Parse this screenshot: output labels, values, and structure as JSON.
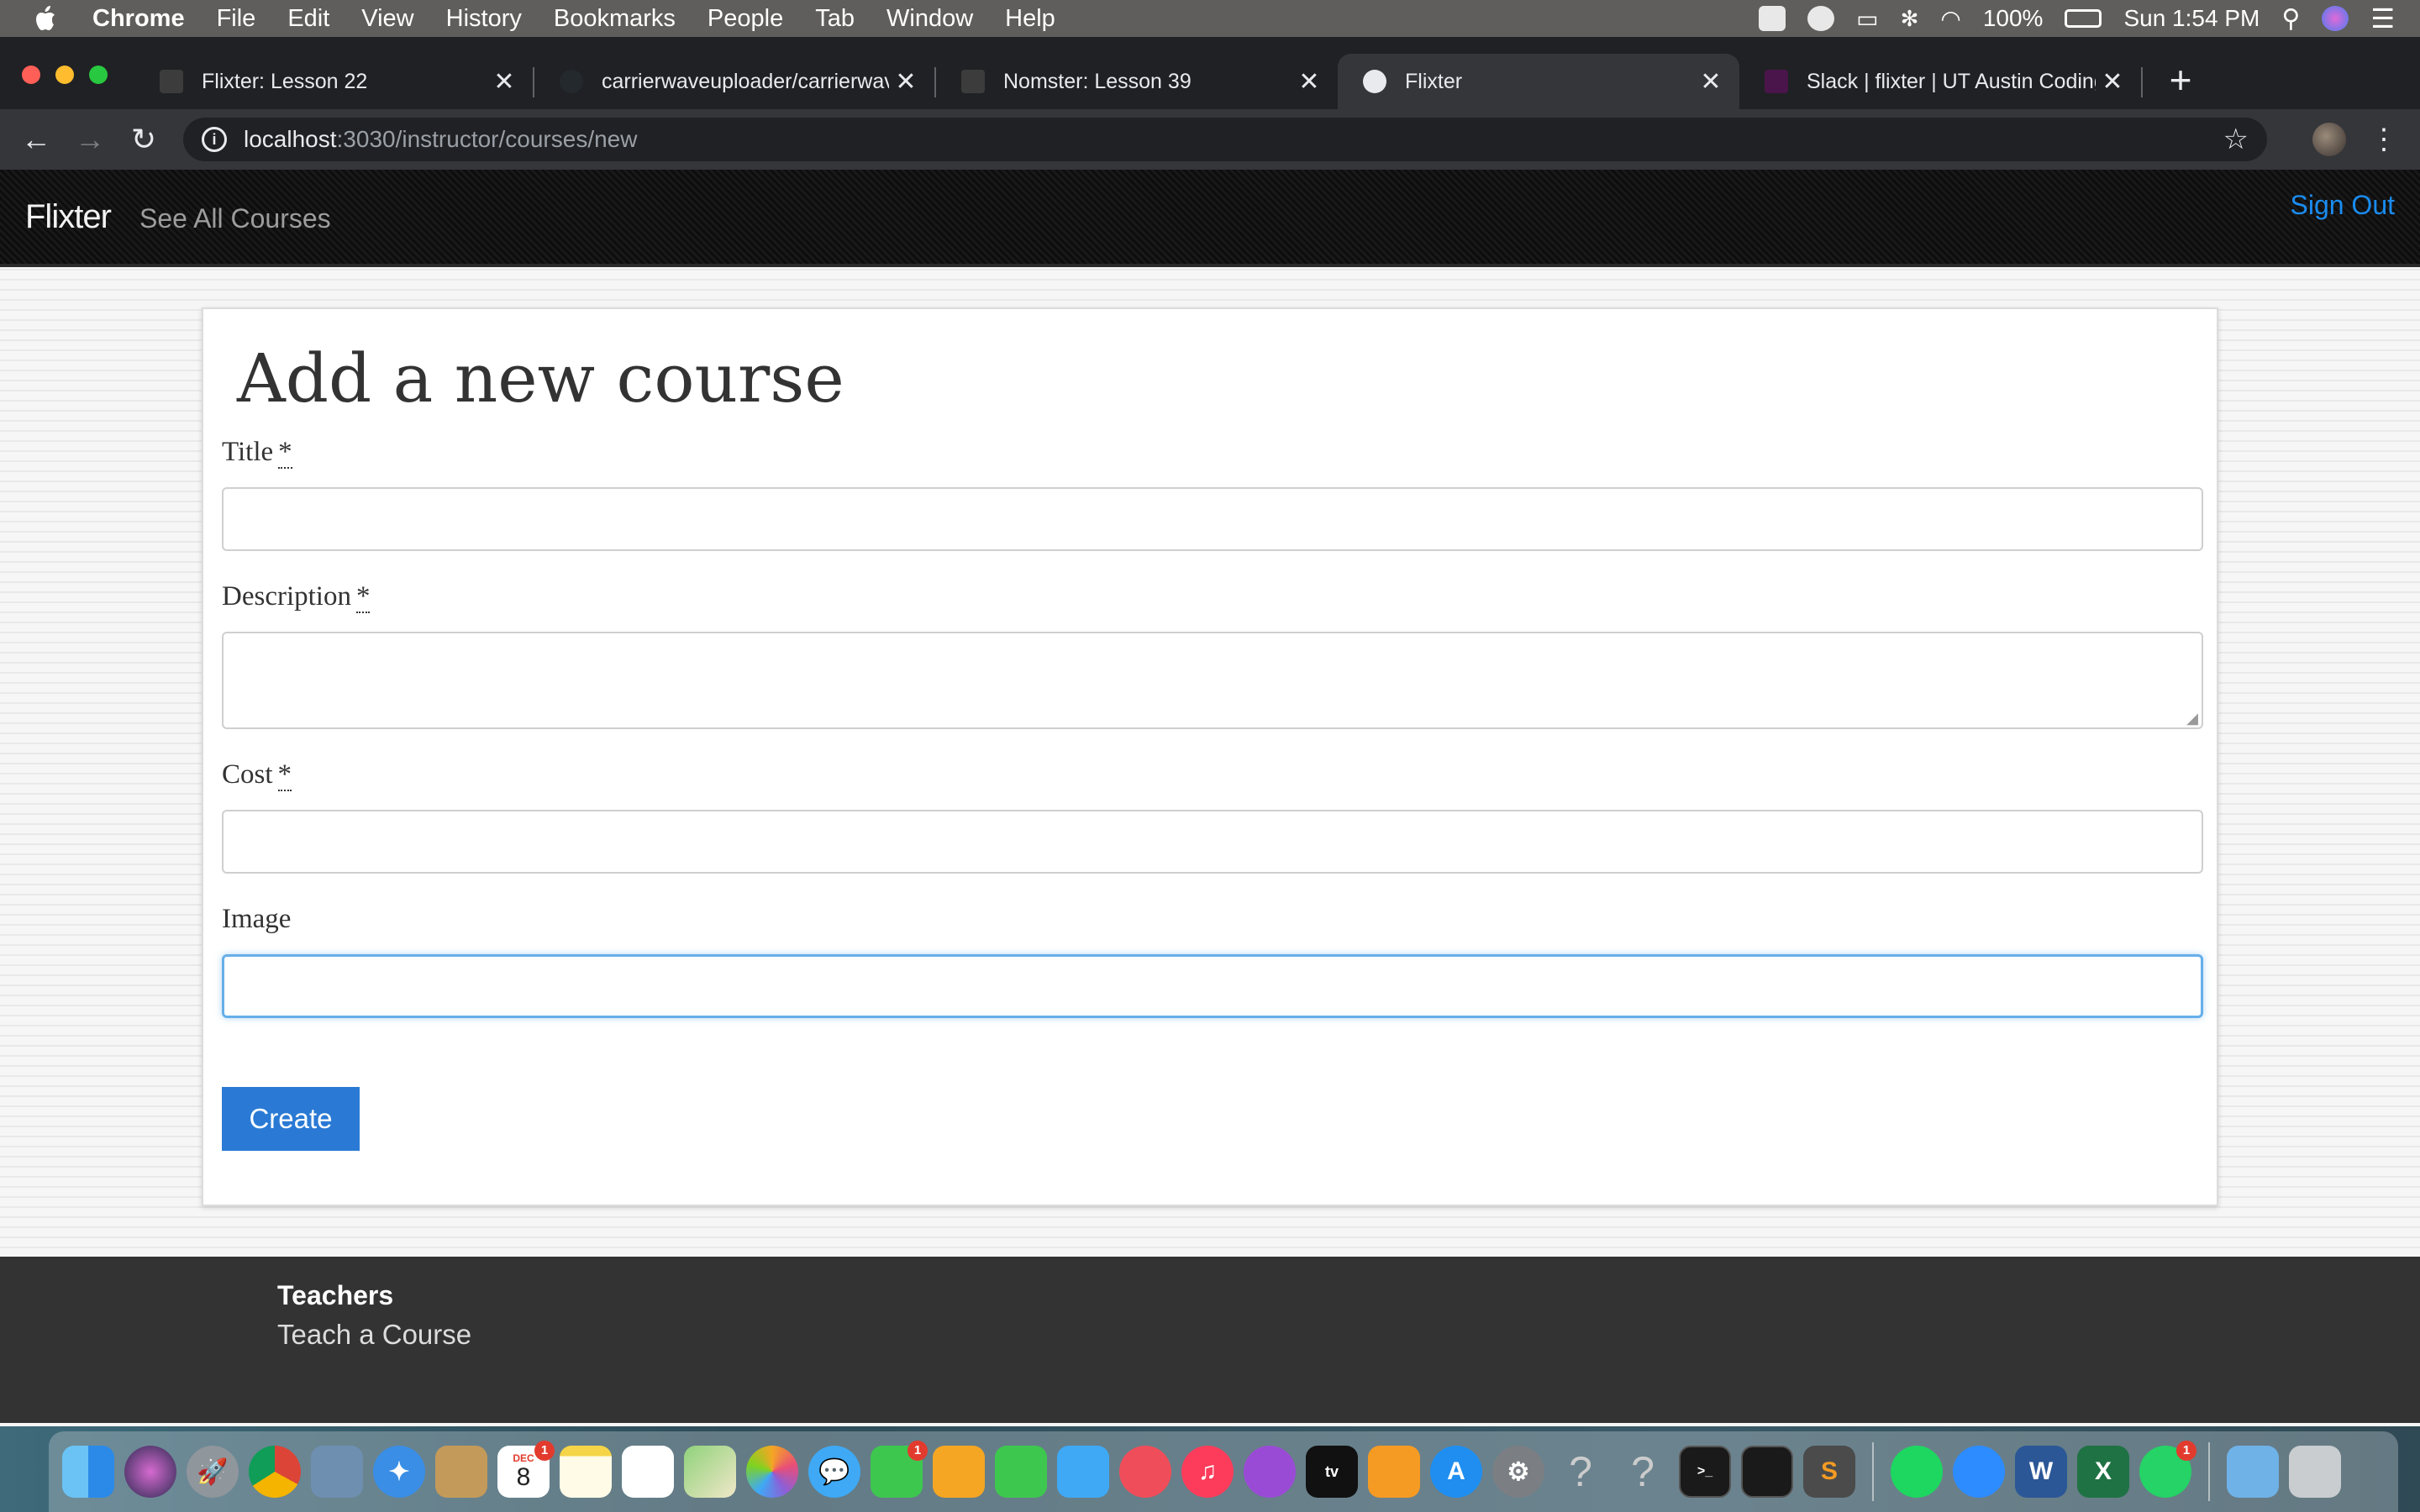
{
  "menubar": {
    "app_name": "Chrome",
    "items": [
      "File",
      "Edit",
      "View",
      "History",
      "Bookmarks",
      "People",
      "Tab",
      "Window",
      "Help"
    ],
    "battery": "100%",
    "clock": "Sun 1:54 PM"
  },
  "tabs": [
    {
      "title": "Flixter: Lesson 22",
      "icon": "page-icon",
      "active": false
    },
    {
      "title": "carrierwaveuploader/carrierwave",
      "icon": "github-icon",
      "active": false
    },
    {
      "title": "Nomster: Lesson 39",
      "icon": "page-icon",
      "active": false
    },
    {
      "title": "Flixter",
      "icon": "globe-icon",
      "active": true
    },
    {
      "title": "Slack | flixter | UT Austin Coding",
      "icon": "slack-icon",
      "active": false
    }
  ],
  "address_bar": {
    "host": "localhost",
    "path": ":3030/instructor/courses/new"
  },
  "site_nav": {
    "brand": "Flixter",
    "see_all_courses": "See All Courses",
    "sign_out": "Sign Out"
  },
  "form": {
    "heading": "Add a new course",
    "required_marker": "*",
    "title_label": "Title",
    "title_value": "",
    "description_label": "Description",
    "description_value": "",
    "cost_label": "Cost",
    "cost_value": "",
    "image_label": "Image",
    "image_value": "",
    "submit_label": "Create"
  },
  "footer": {
    "heading": "Teachers",
    "link": "Teach a Course"
  },
  "dock": {
    "calendar_month": "DEC",
    "calendar_day": "8",
    "badges": {
      "calendar": "1",
      "facetime": "1",
      "whatsapp": "1"
    }
  },
  "colors": {
    "link_blue": "#1a8cf0",
    "button_blue": "#2a7ad5",
    "focus_blue": "#66afe9",
    "navbar_black": "#111111",
    "footer_gray": "#333333"
  }
}
